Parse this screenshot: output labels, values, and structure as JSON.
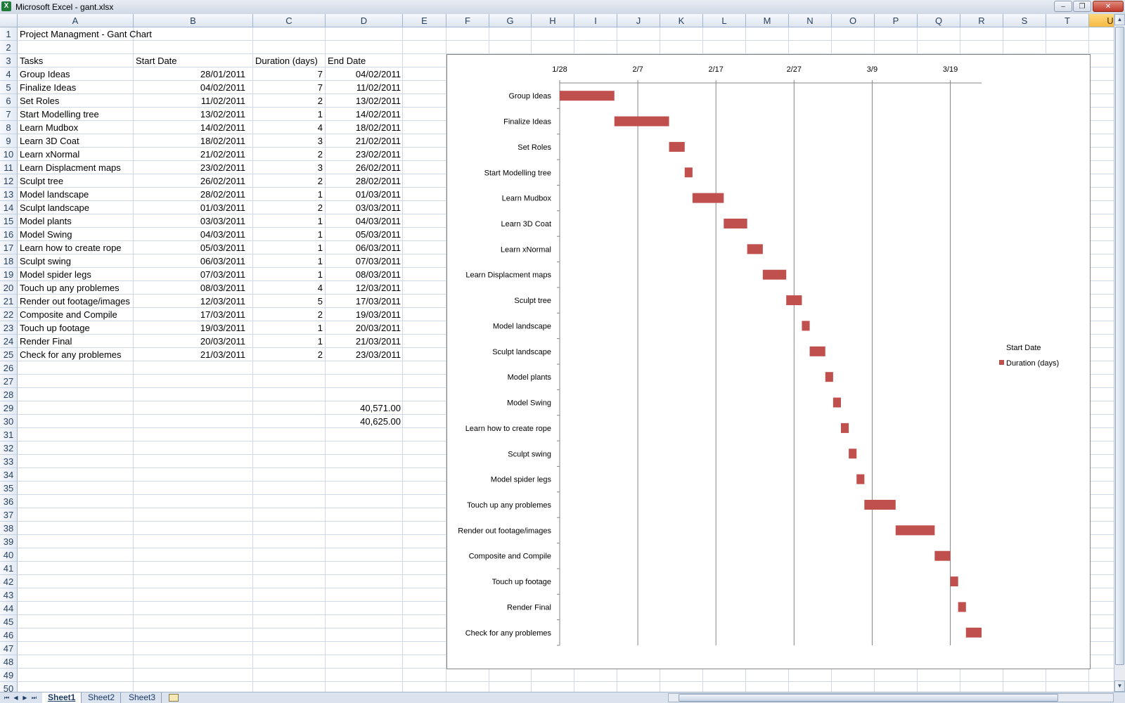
{
  "window": {
    "title": "Microsoft Excel - gant.xlsx",
    "app_icon": "X",
    "minimize": "–",
    "restore": "❐",
    "close": "✕"
  },
  "columns": [
    "A",
    "B",
    "C",
    "D",
    "E",
    "F",
    "G",
    "H",
    "I",
    "J",
    "K",
    "L",
    "M",
    "N",
    "O",
    "P",
    "Q",
    "R",
    "S",
    "T",
    "U"
  ],
  "selected_column": "U",
  "row_numbers": [
    "1",
    "2",
    "3",
    "4",
    "5",
    "6",
    "7",
    "8",
    "9",
    "10",
    "11",
    "12",
    "13",
    "14",
    "15",
    "16",
    "17",
    "18",
    "19",
    "20",
    "21",
    "22",
    "23",
    "24",
    "25",
    "26",
    "27",
    "28",
    "29",
    "30",
    "31",
    "32",
    "33",
    "34",
    "35",
    "36",
    "37",
    "38",
    "39",
    "40",
    "41",
    "42",
    "43",
    "44",
    "45",
    "46",
    "47",
    "48",
    "49",
    "50"
  ],
  "sheet": {
    "title": "Project Managment - Gant Chart",
    "headers": {
      "tasks": "Tasks",
      "start": "Start Date",
      "duration": "Duration (days)",
      "end": "End Date"
    },
    "rows": [
      {
        "task": "Group Ideas",
        "start": "28/01/2011",
        "duration": "7",
        "end": "04/02/2011"
      },
      {
        "task": "Finalize Ideas",
        "start": "04/02/2011",
        "duration": "7",
        "end": "11/02/2011"
      },
      {
        "task": "Set Roles",
        "start": "11/02/2011",
        "duration": "2",
        "end": "13/02/2011"
      },
      {
        "task": "Start Modelling tree",
        "start": "13/02/2011",
        "duration": "1",
        "end": "14/02/2011"
      },
      {
        "task": "Learn Mudbox",
        "start": "14/02/2011",
        "duration": "4",
        "end": "18/02/2011"
      },
      {
        "task": "Learn 3D Coat",
        "start": "18/02/2011",
        "duration": "3",
        "end": "21/02/2011"
      },
      {
        "task": "Learn xNormal",
        "start": "21/02/2011",
        "duration": "2",
        "end": "23/02/2011"
      },
      {
        "task": "Learn Displacment maps",
        "start": "23/02/2011",
        "duration": "3",
        "end": "26/02/2011"
      },
      {
        "task": "Sculpt tree",
        "start": "26/02/2011",
        "duration": "2",
        "end": "28/02/2011"
      },
      {
        "task": "Model landscape",
        "start": "28/02/2011",
        "duration": "1",
        "end": "01/03/2011"
      },
      {
        "task": "Sculpt landscape",
        "start": "01/03/2011",
        "duration": "2",
        "end": "03/03/2011"
      },
      {
        "task": "Model plants",
        "start": "03/03/2011",
        "duration": "1",
        "end": "04/03/2011"
      },
      {
        "task": "Model Swing",
        "start": "04/03/2011",
        "duration": "1",
        "end": "05/03/2011"
      },
      {
        "task": "Learn how to create rope",
        "start": "05/03/2011",
        "duration": "1",
        "end": "06/03/2011"
      },
      {
        "task": "Sculpt swing",
        "start": "06/03/2011",
        "duration": "1",
        "end": "07/03/2011"
      },
      {
        "task": "Model spider legs",
        "start": "07/03/2011",
        "duration": "1",
        "end": "08/03/2011"
      },
      {
        "task": "Touch up any problemes",
        "start": "08/03/2011",
        "duration": "4",
        "end": "12/03/2011"
      },
      {
        "task": "Render out footage/images",
        "start": "12/03/2011",
        "duration": "5",
        "end": "17/03/2011"
      },
      {
        "task": "Composite and Compile",
        "start": "17/03/2011",
        "duration": "2",
        "end": "19/03/2011"
      },
      {
        "task": "Touch up footage",
        "start": "19/03/2011",
        "duration": "1",
        "end": "20/03/2011"
      },
      {
        "task": "Render Final",
        "start": "20/03/2011",
        "duration": "1",
        "end": "21/03/2011"
      },
      {
        "task": "Check for any problemes",
        "start": "21/03/2011",
        "duration": "2",
        "end": "23/03/2011"
      }
    ],
    "extra_values": [
      "40,571.00",
      "40,625.00"
    ]
  },
  "chart_data": {
    "type": "bar",
    "orientation": "horizontal",
    "stacked": true,
    "categories": [
      "Group Ideas",
      "Finalize Ideas",
      "Set Roles",
      "Start Modelling tree",
      "Learn Mudbox",
      "Learn 3D Coat",
      "Learn xNormal",
      "Learn Displacment maps",
      "Sculpt tree",
      "Model landscape",
      "Sculpt landscape",
      "Model plants",
      "Model Swing",
      "Learn how to create rope",
      "Sculpt swing",
      "Model spider legs",
      "Touch up any problemes",
      "Render out footage/images",
      "Composite and Compile",
      "Touch up footage",
      "Render Final",
      "Check for any problemes"
    ],
    "series": [
      {
        "name": "Start Date",
        "values": [
          0,
          7,
          14,
          16,
          17,
          21,
          24,
          26,
          29,
          31,
          32,
          34,
          35,
          36,
          37,
          38,
          39,
          43,
          48,
          50,
          51,
          52
        ],
        "visible": false
      },
      {
        "name": "Duration (days)",
        "values": [
          7,
          7,
          2,
          1,
          4,
          3,
          2,
          3,
          2,
          1,
          2,
          1,
          1,
          1,
          1,
          1,
          4,
          5,
          2,
          1,
          1,
          2
        ],
        "color": "#c0504d"
      }
    ],
    "x_axis_ticks": [
      "1/28",
      "2/7",
      "2/17",
      "2/27",
      "3/9",
      "3/19"
    ],
    "x_tick_values": [
      0,
      10,
      20,
      30,
      40,
      50
    ],
    "xlim": [
      0,
      54
    ],
    "x_axis_position": "top",
    "category_order": "reversed",
    "gridlines": "vertical",
    "legend": {
      "position": "right",
      "entries": [
        "Start Date",
        "Duration (days)"
      ]
    }
  },
  "sheet_tabs": [
    "Sheet1",
    "Sheet2",
    "Sheet3"
  ],
  "active_sheet": "Sheet1",
  "nav_buttons": [
    "⏮",
    "◀",
    "▶",
    "⏭"
  ]
}
